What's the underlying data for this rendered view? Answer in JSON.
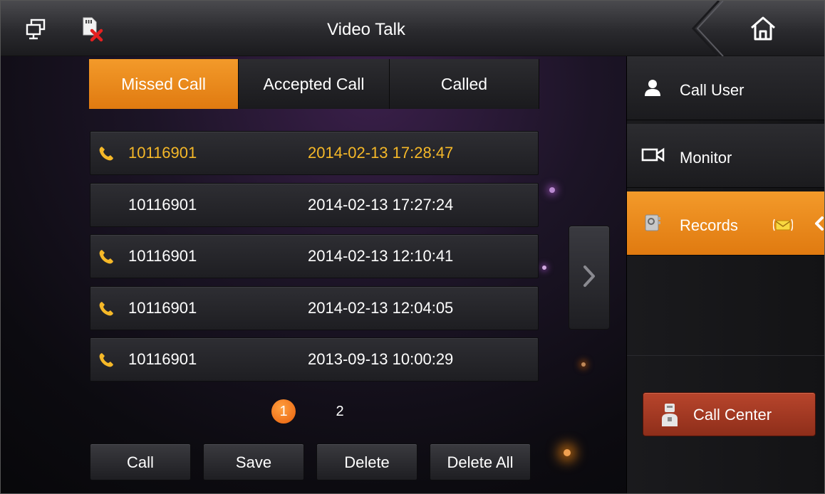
{
  "header": {
    "title": "Video Talk",
    "left_icons": [
      "screen-switch-icon",
      "no-sd-card-icon"
    ],
    "home_icon": "home-icon"
  },
  "tabs": [
    {
      "label": "Missed Call",
      "active": true
    },
    {
      "label": "Accepted Call",
      "active": false
    },
    {
      "label": "Called",
      "active": false
    }
  ],
  "records": [
    {
      "number": "10116901",
      "time": "2014-02-13 17:28:47",
      "phone_icon": true,
      "highlighted": true
    },
    {
      "number": "10116901",
      "time": "2014-02-13 17:27:24",
      "phone_icon": false,
      "highlighted": false
    },
    {
      "number": "10116901",
      "time": "2014-02-13 12:10:41",
      "phone_icon": true,
      "highlighted": false
    },
    {
      "number": "10116901",
      "time": "2014-02-13 12:04:05",
      "phone_icon": true,
      "highlighted": false
    },
    {
      "number": "10116901",
      "time": "2013-09-13 10:00:29",
      "phone_icon": true,
      "highlighted": false
    }
  ],
  "pagination": {
    "pages": [
      "1",
      "2"
    ],
    "current": "1"
  },
  "actions": {
    "call": "Call",
    "save": "Save",
    "delete": "Delete",
    "delete_all": "Delete All"
  },
  "sidebar": {
    "items": [
      {
        "label": "Call User",
        "icon": "user-icon",
        "active": false
      },
      {
        "label": "Monitor",
        "icon": "camera-icon",
        "active": false
      },
      {
        "label": "Records",
        "icon": "records-icon",
        "active": true,
        "badge_icon": "envelope-icon"
      }
    ],
    "call_center": "Call Center"
  },
  "colors": {
    "accent": "#e88a1e",
    "highlight_text": "#f5b828",
    "call_center": "#a33b24"
  }
}
